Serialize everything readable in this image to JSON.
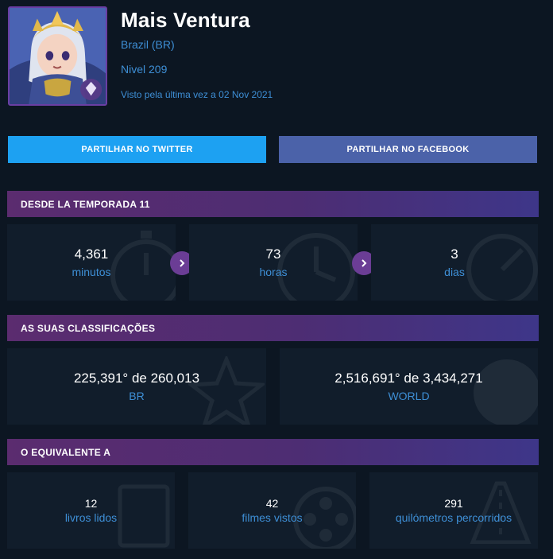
{
  "profile": {
    "name": "Mais Ventura",
    "country": "Brazil (BR)",
    "level": "Nivel 209",
    "last_seen": "Visto pela última vez a 02 Nov 2021",
    "avatar_icon": "champion-portrait-icon"
  },
  "share": {
    "twitter_label": "PARTILHAR NO TWITTER",
    "facebook_label": "PARTILHAR NO FACEBOOK",
    "twitter_color": "#1da1f2",
    "facebook_color": "#4b62a9"
  },
  "season": {
    "header": "DESDE LA TEMPORADA 11",
    "stats": [
      {
        "value": "4,361",
        "label": "minutos",
        "icon": "stopwatch-icon"
      },
      {
        "value": "73",
        "label": "horas",
        "icon": "clock-icon"
      },
      {
        "value": "3",
        "label": "dias",
        "icon": "calendar-icon"
      }
    ]
  },
  "rankings": {
    "header": "AS SUAS CLASSIFICAÇÕES",
    "items": [
      {
        "value": "225,391° de 260,013",
        "label": "BR",
        "icon": "star-icon"
      },
      {
        "value": "2,516,691° de 3,434,271",
        "label": "WORLD",
        "icon": "globe-icon"
      }
    ]
  },
  "equivalent": {
    "header": "O EQUIVALENTE A",
    "items": [
      {
        "value": "12",
        "label": "livros lidos",
        "icon": "book-icon"
      },
      {
        "value": "42",
        "label": "filmes vistos",
        "icon": "film-reel-icon"
      },
      {
        "value": "291",
        "label": "quilómetros percorridos",
        "icon": "road-icon"
      }
    ]
  },
  "colors": {
    "background": "#0c1622",
    "card": "#111d2b",
    "accent_blue": "#3e8fd6",
    "header_purple": "#5b2c6f",
    "arrow_purple": "#6b3d95"
  }
}
